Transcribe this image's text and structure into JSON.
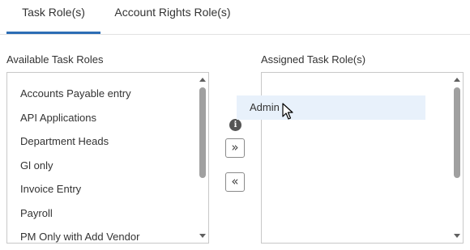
{
  "tabs": [
    {
      "label": "Task Role(s)",
      "active": true
    },
    {
      "label": "Account Rights Role(s)",
      "active": false
    }
  ],
  "available": {
    "title": "Available Task Roles",
    "items": [
      "Accounts Payable entry",
      "API Applications",
      "Department Heads",
      "Gl only",
      "Invoice Entry",
      "Payroll",
      "PM Only with Add Vendor"
    ]
  },
  "assigned": {
    "title": "Assigned Task Role(s)",
    "items": []
  },
  "dragging": {
    "label": "Admin"
  },
  "buttons": {
    "add_symbol": "»",
    "remove_symbol": "«"
  },
  "info_icon": {
    "glyph": "i",
    "icon": "info-icon"
  },
  "colors": {
    "accent": "#2c6db5",
    "drag_highlight": "#e8f1fb"
  }
}
